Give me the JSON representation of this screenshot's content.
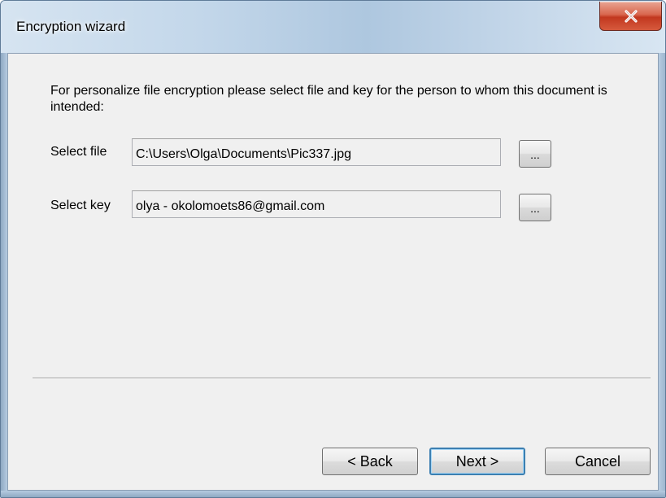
{
  "window": {
    "title": "Encryption wizard"
  },
  "icons": {
    "close": "close-icon"
  },
  "colors": {
    "close_button": "#c2381f",
    "client_background": "#f0f0f0",
    "default_button_border": "#3c7fb1"
  },
  "instructions": "For personalize file encryption please select file and key for the person to whom this document is intended:",
  "file": {
    "label": "Select file",
    "value": "C:\\Users\\Olga\\Documents\\Pic337.jpg",
    "browse_label": "..."
  },
  "key": {
    "label": "Select key",
    "value": "olya - okolomoets86@gmail.com",
    "browse_label": "..."
  },
  "buttons": {
    "back": "< Back",
    "next": "Next >",
    "cancel": "Cancel"
  }
}
